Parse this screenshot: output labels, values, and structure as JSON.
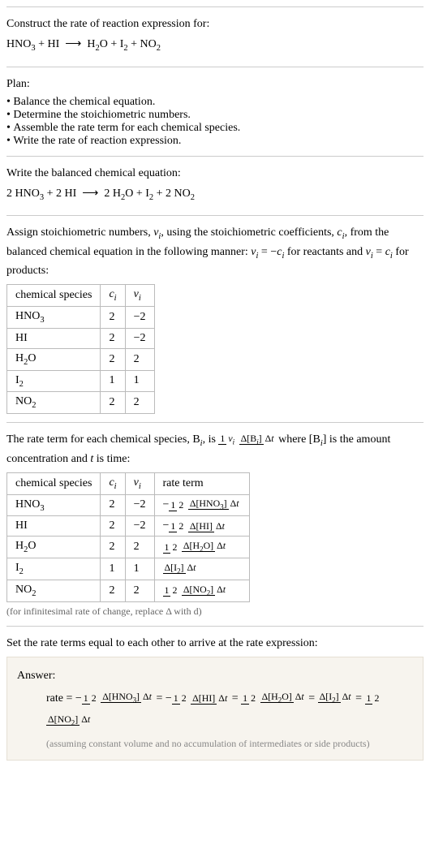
{
  "intro": {
    "title": "Construct the rate of reaction expression for:",
    "equation_html": "HNO<sub>3</sub> + HI &nbsp;&xrarr;&nbsp; H<sub>2</sub>O + I<sub>2</sub> + NO<sub>2</sub>"
  },
  "plan": {
    "title": "Plan:",
    "items": [
      "Balance the chemical equation.",
      "Determine the stoichiometric numbers.",
      "Assemble the rate term for each chemical species.",
      "Write the rate of reaction expression."
    ]
  },
  "balanced": {
    "title": "Write the balanced chemical equation:",
    "equation_html": "2 HNO<sub>3</sub> + 2 HI &nbsp;&xrarr;&nbsp; 2 H<sub>2</sub>O + I<sub>2</sub> + 2 NO<sub>2</sub>"
  },
  "stoich_intro_html": "Assign stoichiometric numbers, <i>ν<sub>i</sub></i>, using the stoichiometric coefficients, <i>c<sub>i</sub></i>, from the balanced chemical equation in the following manner: <i>ν<sub>i</sub></i> = −<i>c<sub>i</sub></i> for reactants and <i>ν<sub>i</sub></i> = <i>c<sub>i</sub></i> for products:",
  "stoich_table": {
    "headers": [
      "chemical species",
      "<i>c<sub>i</sub></i>",
      "<i>ν<sub>i</sub></i>"
    ],
    "rows": [
      [
        "HNO<sub>3</sub>",
        "2",
        "−2"
      ],
      [
        "HI",
        "2",
        "−2"
      ],
      [
        "H<sub>2</sub>O",
        "2",
        "2"
      ],
      [
        "I<sub>2</sub>",
        "1",
        "1"
      ],
      [
        "NO<sub>2</sub>",
        "2",
        "2"
      ]
    ]
  },
  "rate_term_intro_html": "The rate term for each chemical species, B<sub><i>i</i></sub>, is <span class=\"frac inl\"><span class=\"num\">1</span><span class=\"den\"><i>ν<sub>i</sub></i></span></span> <span class=\"frac inl\"><span class=\"num\">Δ[B<sub><i>i</i></sub>]</span><span class=\"den\">Δ<i>t</i></span></span> where [B<sub><i>i</i></sub>] is the amount concentration and <i>t</i> is time:",
  "rate_table": {
    "headers": [
      "chemical species",
      "<i>c<sub>i</sub></i>",
      "<i>ν<sub>i</sub></i>",
      "rate term"
    ],
    "rows": [
      [
        "HNO<sub>3</sub>",
        "2",
        "−2",
        "−<span class=\"frac inl\"><span class=\"num\">1</span><span class=\"den\">2</span></span> <span class=\"frac inl\"><span class=\"num\">Δ[HNO<sub>3</sub>]</span><span class=\"den\">Δ<i>t</i></span></span>"
      ],
      [
        "HI",
        "2",
        "−2",
        "−<span class=\"frac inl\"><span class=\"num\">1</span><span class=\"den\">2</span></span> <span class=\"frac inl\"><span class=\"num\">Δ[HI]</span><span class=\"den\">Δ<i>t</i></span></span>"
      ],
      [
        "H<sub>2</sub>O",
        "2",
        "2",
        "<span class=\"frac inl\"><span class=\"num\">1</span><span class=\"den\">2</span></span> <span class=\"frac inl\"><span class=\"num\">Δ[H<sub>2</sub>O]</span><span class=\"den\">Δ<i>t</i></span></span>"
      ],
      [
        "I<sub>2</sub>",
        "1",
        "1",
        "<span class=\"frac inl\"><span class=\"num\">Δ[I<sub>2</sub>]</span><span class=\"den\">Δ<i>t</i></span></span>"
      ],
      [
        "NO<sub>2</sub>",
        "2",
        "2",
        "<span class=\"frac inl\"><span class=\"num\">1</span><span class=\"den\">2</span></span> <span class=\"frac inl\"><span class=\"num\">Δ[NO<sub>2</sub>]</span><span class=\"den\">Δ<i>t</i></span></span>"
      ]
    ]
  },
  "infinitesimal_note": "(for infinitesimal rate of change, replace Δ with d)",
  "final_intro": "Set the rate terms equal to each other to arrive at the rate expression:",
  "answer": {
    "title": "Answer:",
    "expr_html": "rate = −<span class=\"frac inl\"><span class=\"num\">1</span><span class=\"den\">2</span></span> <span class=\"frac inl\"><span class=\"num\">Δ[HNO<sub>3</sub>]</span><span class=\"den\">Δ<i>t</i></span></span> = −<span class=\"frac inl\"><span class=\"num\">1</span><span class=\"den\">2</span></span> <span class=\"frac inl\"><span class=\"num\">Δ[HI]</span><span class=\"den\">Δ<i>t</i></span></span> = <span class=\"frac inl\"><span class=\"num\">1</span><span class=\"den\">2</span></span> <span class=\"frac inl\"><span class=\"num\">Δ[H<sub>2</sub>O]</span><span class=\"den\">Δ<i>t</i></span></span> = <span class=\"frac inl\"><span class=\"num\">Δ[I<sub>2</sub>]</span><span class=\"den\">Δ<i>t</i></span></span> = <span class=\"frac inl\"><span class=\"num\">1</span><span class=\"den\">2</span></span> <span class=\"frac inl\"><span class=\"num\">Δ[NO<sub>2</sub>]</span><span class=\"den\">Δ<i>t</i></span></span>",
    "note": "(assuming constant volume and no accumulation of intermediates or side products)"
  },
  "chart_data": {
    "type": "table",
    "tables": [
      {
        "title": "Stoichiometric numbers",
        "columns": [
          "chemical species",
          "c_i",
          "nu_i"
        ],
        "rows": [
          [
            "HNO3",
            2,
            -2
          ],
          [
            "HI",
            2,
            -2
          ],
          [
            "H2O",
            2,
            2
          ],
          [
            "I2",
            1,
            1
          ],
          [
            "NO2",
            2,
            2
          ]
        ]
      },
      {
        "title": "Rate terms",
        "columns": [
          "chemical species",
          "c_i",
          "nu_i",
          "rate term"
        ],
        "rows": [
          [
            "HNO3",
            2,
            -2,
            "-(1/2) d[HNO3]/dt"
          ],
          [
            "HI",
            2,
            -2,
            "-(1/2) d[HI]/dt"
          ],
          [
            "H2O",
            2,
            2,
            "(1/2) d[H2O]/dt"
          ],
          [
            "I2",
            1,
            1,
            "d[I2]/dt"
          ],
          [
            "NO2",
            2,
            2,
            "(1/2) d[NO2]/dt"
          ]
        ]
      }
    ]
  }
}
